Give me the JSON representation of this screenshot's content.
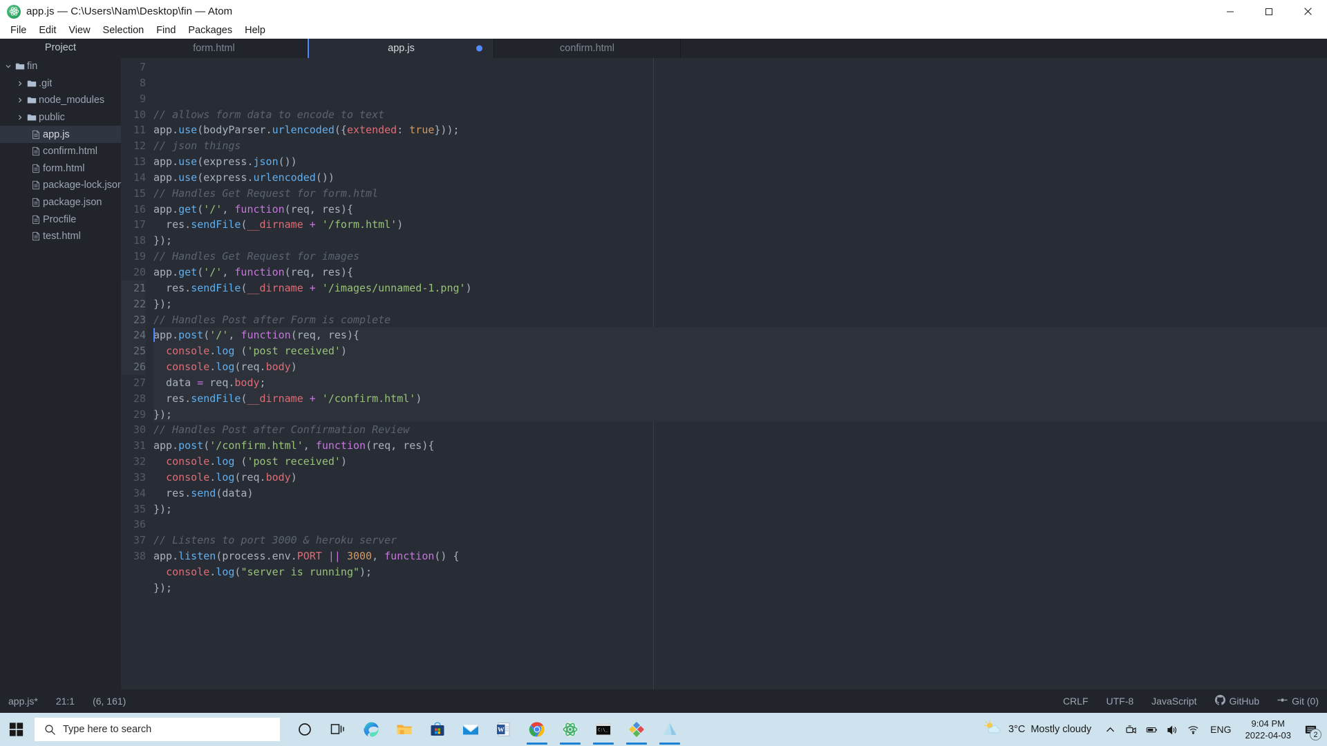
{
  "window": {
    "title": "app.js — C:\\Users\\Nam\\Desktop\\fin — Atom",
    "logo_icon": "atom-logo-icon",
    "minimize_label": "Minimize",
    "maximize_label": "Maximize",
    "close_label": "Close"
  },
  "menubar": {
    "items": [
      {
        "label": "File"
      },
      {
        "label": "Edit"
      },
      {
        "label": "View"
      },
      {
        "label": "Selection"
      },
      {
        "label": "Find"
      },
      {
        "label": "Packages"
      },
      {
        "label": "Help"
      }
    ]
  },
  "sidebar": {
    "header": "Project",
    "tree": [
      {
        "label": "fin",
        "type": "folder",
        "depth": 0,
        "expanded": true,
        "selected": false
      },
      {
        "label": ".git",
        "type": "folder",
        "depth": 1,
        "expanded": false,
        "selected": false
      },
      {
        "label": "node_modules",
        "type": "folder",
        "depth": 1,
        "expanded": false,
        "selected": false
      },
      {
        "label": "public",
        "type": "folder",
        "depth": 1,
        "expanded": false,
        "selected": false
      },
      {
        "label": "app.js",
        "type": "file",
        "depth": 2,
        "selected": true
      },
      {
        "label": "confirm.html",
        "type": "file",
        "depth": 2,
        "selected": false
      },
      {
        "label": "form.html",
        "type": "file",
        "depth": 2,
        "selected": false
      },
      {
        "label": "package-lock.json",
        "type": "file",
        "depth": 2,
        "selected": false
      },
      {
        "label": "package.json",
        "type": "file",
        "depth": 2,
        "selected": false
      },
      {
        "label": "Procfile",
        "type": "file",
        "depth": 2,
        "selected": false
      },
      {
        "label": "test.html",
        "type": "file",
        "depth": 2,
        "selected": false
      }
    ]
  },
  "tabs": [
    {
      "label": "form.html",
      "active": false,
      "modified": false
    },
    {
      "label": "app.js",
      "active": true,
      "modified": true
    },
    {
      "label": "confirm.html",
      "active": false,
      "modified": false
    }
  ],
  "editor": {
    "first_line": 7,
    "cursor_line": 21,
    "selection_start_line": 21,
    "selection_end_line": 26,
    "lines": [
      {
        "n": 7,
        "tokens": [
          {
            "t": "// allows form data to encode to text",
            "c": "c-com"
          }
        ]
      },
      {
        "n": 8,
        "tokens": [
          {
            "t": "app",
            "c": "c-def"
          },
          {
            "t": ".",
            "c": "c-punc"
          },
          {
            "t": "use",
            "c": "c-fn"
          },
          {
            "t": "(bodyParser",
            "c": "c-def"
          },
          {
            "t": ".",
            "c": "c-punc"
          },
          {
            "t": "urlencoded",
            "c": "c-fn"
          },
          {
            "t": "({",
            "c": "c-punc"
          },
          {
            "t": "extended",
            "c": "c-var"
          },
          {
            "t": ": ",
            "c": "c-punc"
          },
          {
            "t": "true",
            "c": "c-num"
          },
          {
            "t": "}));",
            "c": "c-punc"
          }
        ]
      },
      {
        "n": 9,
        "tokens": [
          {
            "t": "// json things",
            "c": "c-com"
          }
        ]
      },
      {
        "n": 10,
        "tokens": [
          {
            "t": "app",
            "c": "c-def"
          },
          {
            "t": ".",
            "c": "c-punc"
          },
          {
            "t": "use",
            "c": "c-fn"
          },
          {
            "t": "(express",
            "c": "c-def"
          },
          {
            "t": ".",
            "c": "c-punc"
          },
          {
            "t": "json",
            "c": "c-fn"
          },
          {
            "t": "())",
            "c": "c-punc"
          }
        ]
      },
      {
        "n": 11,
        "tokens": [
          {
            "t": "app",
            "c": "c-def"
          },
          {
            "t": ".",
            "c": "c-punc"
          },
          {
            "t": "use",
            "c": "c-fn"
          },
          {
            "t": "(express",
            "c": "c-def"
          },
          {
            "t": ".",
            "c": "c-punc"
          },
          {
            "t": "urlencoded",
            "c": "c-fn"
          },
          {
            "t": "())",
            "c": "c-punc"
          }
        ]
      },
      {
        "n": 12,
        "tokens": [
          {
            "t": "// Handles Get Request for form.html",
            "c": "c-com"
          }
        ]
      },
      {
        "n": 13,
        "tokens": [
          {
            "t": "app",
            "c": "c-def"
          },
          {
            "t": ".",
            "c": "c-punc"
          },
          {
            "t": "get",
            "c": "c-fn"
          },
          {
            "t": "(",
            "c": "c-punc"
          },
          {
            "t": "'/'",
            "c": "c-str"
          },
          {
            "t": ", ",
            "c": "c-punc"
          },
          {
            "t": "function",
            "c": "c-key"
          },
          {
            "t": "(req, res){",
            "c": "c-def"
          }
        ]
      },
      {
        "n": 14,
        "tokens": [
          {
            "t": "  res",
            "c": "c-def"
          },
          {
            "t": ".",
            "c": "c-punc"
          },
          {
            "t": "sendFile",
            "c": "c-fn"
          },
          {
            "t": "(",
            "c": "c-punc"
          },
          {
            "t": "__dirname",
            "c": "c-var"
          },
          {
            "t": " ",
            "c": "c-def"
          },
          {
            "t": "+",
            "c": "c-op"
          },
          {
            "t": " ",
            "c": "c-def"
          },
          {
            "t": "'/form.html'",
            "c": "c-str"
          },
          {
            "t": ")",
            "c": "c-punc"
          }
        ]
      },
      {
        "n": 15,
        "tokens": [
          {
            "t": "});",
            "c": "c-punc"
          }
        ]
      },
      {
        "n": 16,
        "tokens": [
          {
            "t": "// Handles Get Request for images",
            "c": "c-com"
          }
        ]
      },
      {
        "n": 17,
        "tokens": [
          {
            "t": "app",
            "c": "c-def"
          },
          {
            "t": ".",
            "c": "c-punc"
          },
          {
            "t": "get",
            "c": "c-fn"
          },
          {
            "t": "(",
            "c": "c-punc"
          },
          {
            "t": "'/'",
            "c": "c-str"
          },
          {
            "t": ", ",
            "c": "c-punc"
          },
          {
            "t": "function",
            "c": "c-key"
          },
          {
            "t": "(req, res){",
            "c": "c-def"
          }
        ]
      },
      {
        "n": 18,
        "tokens": [
          {
            "t": "  res",
            "c": "c-def"
          },
          {
            "t": ".",
            "c": "c-punc"
          },
          {
            "t": "sendFile",
            "c": "c-fn"
          },
          {
            "t": "(",
            "c": "c-punc"
          },
          {
            "t": "__dirname",
            "c": "c-var"
          },
          {
            "t": " ",
            "c": "c-def"
          },
          {
            "t": "+",
            "c": "c-op"
          },
          {
            "t": " ",
            "c": "c-def"
          },
          {
            "t": "'/images/unnamed-1.png'",
            "c": "c-str"
          },
          {
            "t": ")",
            "c": "c-punc"
          }
        ]
      },
      {
        "n": 19,
        "tokens": [
          {
            "t": "});",
            "c": "c-punc"
          }
        ]
      },
      {
        "n": 20,
        "tokens": [
          {
            "t": "// Handles Post after Form is complete",
            "c": "c-com"
          }
        ]
      },
      {
        "n": 21,
        "tokens": [
          {
            "t": "app",
            "c": "c-def"
          },
          {
            "t": ".",
            "c": "c-punc"
          },
          {
            "t": "post",
            "c": "c-fn"
          },
          {
            "t": "(",
            "c": "c-punc"
          },
          {
            "t": "'/'",
            "c": "c-str"
          },
          {
            "t": ", ",
            "c": "c-punc"
          },
          {
            "t": "function",
            "c": "c-key"
          },
          {
            "t": "(req, res){",
            "c": "c-def"
          }
        ]
      },
      {
        "n": 22,
        "tokens": [
          {
            "t": "  ",
            "c": "c-def"
          },
          {
            "t": "console",
            "c": "c-var"
          },
          {
            "t": ".",
            "c": "c-punc"
          },
          {
            "t": "log",
            "c": "c-fn"
          },
          {
            "t": " (",
            "c": "c-punc"
          },
          {
            "t": "'post received'",
            "c": "c-str"
          },
          {
            "t": ")",
            "c": "c-punc"
          }
        ]
      },
      {
        "n": 23,
        "tokens": [
          {
            "t": "  ",
            "c": "c-def"
          },
          {
            "t": "console",
            "c": "c-var"
          },
          {
            "t": ".",
            "c": "c-punc"
          },
          {
            "t": "log",
            "c": "c-fn"
          },
          {
            "t": "(req",
            "c": "c-def"
          },
          {
            "t": ".",
            "c": "c-punc"
          },
          {
            "t": "body",
            "c": "c-var"
          },
          {
            "t": ")",
            "c": "c-punc"
          }
        ]
      },
      {
        "n": 24,
        "tokens": [
          {
            "t": "  data ",
            "c": "c-def"
          },
          {
            "t": "=",
            "c": "c-op"
          },
          {
            "t": " req",
            "c": "c-def"
          },
          {
            "t": ".",
            "c": "c-punc"
          },
          {
            "t": "body",
            "c": "c-var"
          },
          {
            "t": ";",
            "c": "c-punc"
          }
        ]
      },
      {
        "n": 25,
        "tokens": [
          {
            "t": "  res",
            "c": "c-def"
          },
          {
            "t": ".",
            "c": "c-punc"
          },
          {
            "t": "sendFile",
            "c": "c-fn"
          },
          {
            "t": "(",
            "c": "c-punc"
          },
          {
            "t": "__dirname",
            "c": "c-var"
          },
          {
            "t": " ",
            "c": "c-def"
          },
          {
            "t": "+",
            "c": "c-op"
          },
          {
            "t": " ",
            "c": "c-def"
          },
          {
            "t": "'/confirm.html'",
            "c": "c-str"
          },
          {
            "t": ")",
            "c": "c-punc"
          }
        ]
      },
      {
        "n": 26,
        "tokens": [
          {
            "t": "});",
            "c": "c-punc"
          }
        ]
      },
      {
        "n": 27,
        "tokens": [
          {
            "t": "// Handles Post after Confirmation Review",
            "c": "c-com"
          }
        ]
      },
      {
        "n": 28,
        "tokens": [
          {
            "t": "app",
            "c": "c-def"
          },
          {
            "t": ".",
            "c": "c-punc"
          },
          {
            "t": "post",
            "c": "c-fn"
          },
          {
            "t": "(",
            "c": "c-punc"
          },
          {
            "t": "'/confirm.html'",
            "c": "c-str"
          },
          {
            "t": ", ",
            "c": "c-punc"
          },
          {
            "t": "function",
            "c": "c-key"
          },
          {
            "t": "(req, res){",
            "c": "c-def"
          }
        ]
      },
      {
        "n": 29,
        "tokens": [
          {
            "t": "  ",
            "c": "c-def"
          },
          {
            "t": "console",
            "c": "c-var"
          },
          {
            "t": ".",
            "c": "c-punc"
          },
          {
            "t": "log",
            "c": "c-fn"
          },
          {
            "t": " (",
            "c": "c-punc"
          },
          {
            "t": "'post received'",
            "c": "c-str"
          },
          {
            "t": ")",
            "c": "c-punc"
          }
        ]
      },
      {
        "n": 30,
        "tokens": [
          {
            "t": "  ",
            "c": "c-def"
          },
          {
            "t": "console",
            "c": "c-var"
          },
          {
            "t": ".",
            "c": "c-punc"
          },
          {
            "t": "log",
            "c": "c-fn"
          },
          {
            "t": "(req",
            "c": "c-def"
          },
          {
            "t": ".",
            "c": "c-punc"
          },
          {
            "t": "body",
            "c": "c-var"
          },
          {
            "t": ")",
            "c": "c-punc"
          }
        ]
      },
      {
        "n": 31,
        "tokens": [
          {
            "t": "  res",
            "c": "c-def"
          },
          {
            "t": ".",
            "c": "c-punc"
          },
          {
            "t": "send",
            "c": "c-fn"
          },
          {
            "t": "(data)",
            "c": "c-def"
          }
        ]
      },
      {
        "n": 32,
        "tokens": [
          {
            "t": "});",
            "c": "c-punc"
          }
        ]
      },
      {
        "n": 33,
        "tokens": []
      },
      {
        "n": 34,
        "tokens": [
          {
            "t": "// Listens to port 3000 & heroku server",
            "c": "c-com"
          }
        ]
      },
      {
        "n": 35,
        "tokens": [
          {
            "t": "app",
            "c": "c-def"
          },
          {
            "t": ".",
            "c": "c-punc"
          },
          {
            "t": "listen",
            "c": "c-fn"
          },
          {
            "t": "(process",
            "c": "c-def"
          },
          {
            "t": ".",
            "c": "c-punc"
          },
          {
            "t": "env",
            "c": "c-def"
          },
          {
            "t": ".",
            "c": "c-punc"
          },
          {
            "t": "PORT",
            "c": "c-var"
          },
          {
            "t": " ",
            "c": "c-def"
          },
          {
            "t": "||",
            "c": "c-op"
          },
          {
            "t": " ",
            "c": "c-def"
          },
          {
            "t": "3000",
            "c": "c-num"
          },
          {
            "t": ", ",
            "c": "c-punc"
          },
          {
            "t": "function",
            "c": "c-key"
          },
          {
            "t": "() {",
            "c": "c-def"
          }
        ]
      },
      {
        "n": 36,
        "tokens": [
          {
            "t": "  ",
            "c": "c-def"
          },
          {
            "t": "console",
            "c": "c-var"
          },
          {
            "t": ".",
            "c": "c-punc"
          },
          {
            "t": "log",
            "c": "c-fn"
          },
          {
            "t": "(",
            "c": "c-punc"
          },
          {
            "t": "\"server is running\"",
            "c": "c-str"
          },
          {
            "t": ");",
            "c": "c-punc"
          }
        ]
      },
      {
        "n": 37,
        "tokens": [
          {
            "t": "});",
            "c": "c-punc"
          }
        ]
      },
      {
        "n": 38,
        "tokens": []
      }
    ]
  },
  "statusbar": {
    "file": "app.js*",
    "cursor": "21:1",
    "selection": "(6, 161)",
    "line_ending": "CRLF",
    "encoding": "UTF-8",
    "grammar": "JavaScript",
    "github": "GitHub",
    "git": "Git (0)",
    "github_icon": "github-octocat-icon",
    "git_icon": "git-branch-icon"
  },
  "taskbar": {
    "start_icon": "windows-start-icon",
    "search": {
      "placeholder": "Type here to search",
      "icon": "search-icon"
    },
    "items": [
      {
        "name": "cortana",
        "icon": "cortana-icon",
        "running": false
      },
      {
        "name": "task-view",
        "icon": "task-view-icon",
        "running": false
      },
      {
        "name": "microsoft-edge",
        "icon": "edge-icon",
        "running": false
      },
      {
        "name": "file-explorer",
        "icon": "file-explorer-icon",
        "running": false
      },
      {
        "name": "microsoft-store",
        "icon": "store-icon",
        "running": false
      },
      {
        "name": "mail",
        "icon": "mail-icon",
        "running": false
      },
      {
        "name": "word",
        "icon": "word-icon",
        "running": false
      },
      {
        "name": "google-chrome",
        "icon": "chrome-icon",
        "running": true
      },
      {
        "name": "atom",
        "icon": "atom-icon",
        "running": true
      },
      {
        "name": "command-prompt",
        "icon": "terminal-icon",
        "running": true
      },
      {
        "name": "visual-studio",
        "icon": "visual-studio-icon",
        "running": true
      },
      {
        "name": "heroku",
        "icon": "heroku-icon",
        "running": true
      }
    ],
    "tray": {
      "weather_temp": "3°C",
      "weather_desc": "Mostly cloudy",
      "weather_icon": "partly-cloudy-icon",
      "chevron_icon": "chevron-up-icon",
      "meet_icon": "meet-now-icon",
      "battery_icon": "battery-icon",
      "volume_icon": "volume-icon",
      "network_icon": "wifi-icon",
      "language": "ENG",
      "time": "9:04 PM",
      "date": "2022-04-03",
      "notification_icon": "notification-icon",
      "notification_count": "2"
    }
  },
  "colors": {
    "accent": "#528bff",
    "editor_bg": "#282c34",
    "sidebar_bg": "#21252b",
    "taskbar_bg": "#cfe3ef"
  }
}
